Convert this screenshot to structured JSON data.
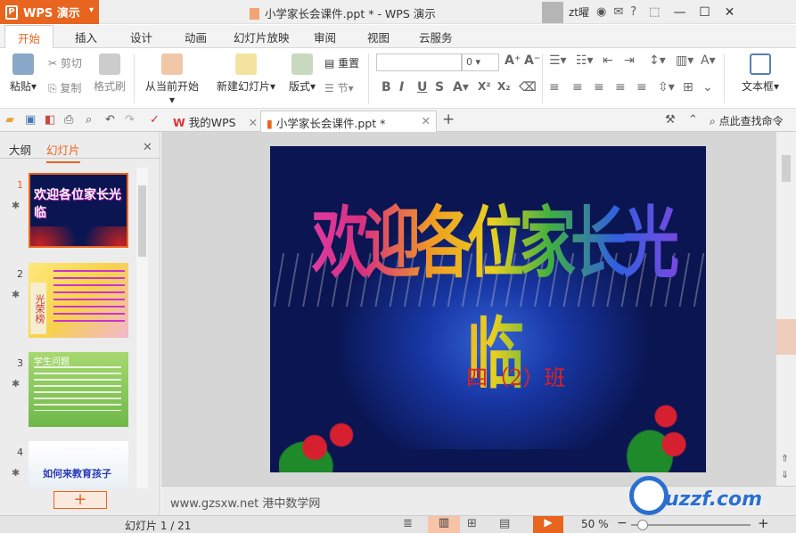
{
  "app": {
    "name": "WPS 演示",
    "doc_title": "小学家长会课件.ppt * - WPS 演示",
    "user": "zt曜"
  },
  "tabs": [
    "开始",
    "插入",
    "设计",
    "动画",
    "幻灯片放映",
    "审阅",
    "视图",
    "云服务"
  ],
  "ribbon": {
    "paste": "粘贴",
    "cut": "剪切",
    "copy": "复制",
    "format_painter": "格式刷",
    "from_current": "从当前开始",
    "new_slide": "新建幻灯片",
    "layout": "版式",
    "reset": "重置",
    "section": "节",
    "font_size": "0",
    "textbox": "文本框"
  },
  "doc_tabs": {
    "my_wps": "我的WPS",
    "current": "小学家长会课件.ppt *",
    "search": "点此查找命令"
  },
  "left_panel": {
    "outline_tab": "大纲",
    "slides_tab": "幻灯片",
    "thumbs": [
      {
        "num": "1",
        "text": "欢迎各位家长光临"
      },
      {
        "num": "2",
        "text": "光荣榜"
      },
      {
        "num": "3",
        "text": "学生问题"
      },
      {
        "num": "4",
        "text": "如何来教育孩子"
      }
    ],
    "add": "+"
  },
  "slide": {
    "title": "欢迎各位家长光临",
    "subtitle": "四（2）班"
  },
  "notes": "www.gzsxw.net 港中数学网",
  "status": {
    "slide_counter": "幻灯片 1 / 21",
    "zoom": "50 %",
    "zoom_level": 0.1
  },
  "watermark": "uzzf.com",
  "colors": {
    "accent": "#e8651f",
    "slide_bg": "#0a1552"
  }
}
